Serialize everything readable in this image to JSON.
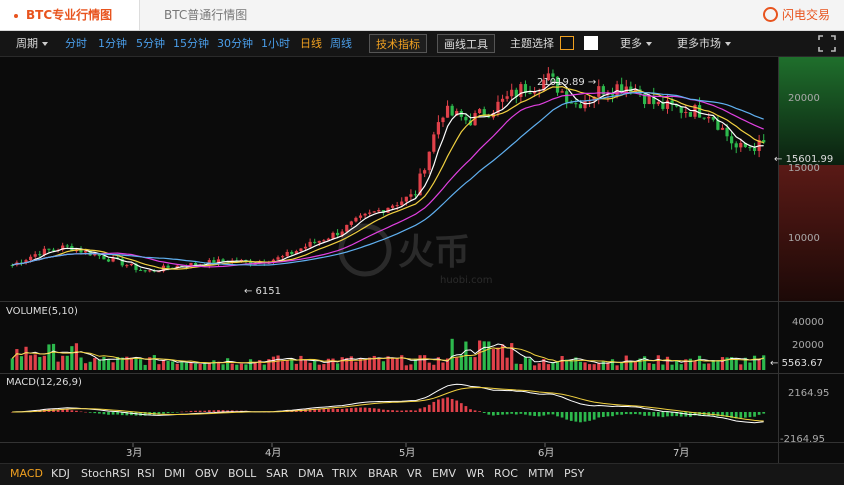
{
  "tabs": {
    "pro": "BTC专业行情图",
    "basic": "BTC普通行情图"
  },
  "brand": "闪电交易",
  "toolbar": {
    "period_label": "周期",
    "periods": [
      "分时",
      "1分钟",
      "5分钟",
      "15分钟",
      "30分钟",
      "1小时",
      "日线",
      "周线"
    ],
    "active_period": "日线",
    "tech_button": "技术指标",
    "draw_button": "画线工具",
    "theme_label": "主题选择",
    "more": "更多",
    "more_markets": "更多市场"
  },
  "colors": {
    "up": "#e0414a",
    "down": "#2db94d",
    "ma5": "#ffffff",
    "ma10": "#f0d040",
    "ma20": "#e040e0",
    "ma30": "#60b0f0",
    "accent": "#f0a020"
  },
  "watermark": {
    "main": "火币",
    "sub": "huobi.com"
  },
  "price_axis": [
    "20000",
    "15000",
    "10000"
  ],
  "price_tag": "15601.99",
  "annotations": {
    "high": "21019.89 →",
    "low": "← 6151"
  },
  "volume_panel": {
    "title": "VOLUME(5,10)",
    "axis": [
      "40000",
      "20000"
    ],
    "tag": "5563.67"
  },
  "macd_panel": {
    "title": "MACD(12,26,9)",
    "axis": [
      "2164.95",
      "-2164.95"
    ]
  },
  "x_axis": [
    "3月",
    "4月",
    "5月",
    "6月",
    "7月"
  ],
  "indicators": [
    "MACD",
    "KDJ",
    "StochRSI",
    "RSI",
    "DMI",
    "OBV",
    "BOLL",
    "SAR",
    "DMA",
    "TRIX",
    "BRAR",
    "VR",
    "EMV",
    "WR",
    "ROC",
    "MTM",
    "PSY"
  ],
  "active_indicator": "MACD",
  "chart_data": {
    "type": "candlestick",
    "x_months": [
      "3月",
      "4月",
      "5月",
      "6月",
      "7月"
    ],
    "price_ylim": [
      6000,
      22000
    ],
    "price_ticks": [
      10000,
      15000,
      20000
    ],
    "last_price": 15601.99,
    "high": 21019.89,
    "low": 6151,
    "close_path": [
      7000,
      7900,
      8300,
      7800,
      7200,
      6500,
      6900,
      7100,
      7300,
      7200,
      7500,
      8400,
      9200,
      10300,
      11200,
      12000,
      18000,
      17300,
      18300,
      19600,
      20300,
      18500,
      19600,
      19900,
      18400,
      18100,
      17900,
      15300,
      15602
    ],
    "volume_ylim": [
      0,
      45000
    ],
    "volume_ticks": [
      20000,
      40000
    ],
    "last_volume": 5563.67,
    "macd_ylim": [
      -2164.95,
      2164.95
    ]
  }
}
